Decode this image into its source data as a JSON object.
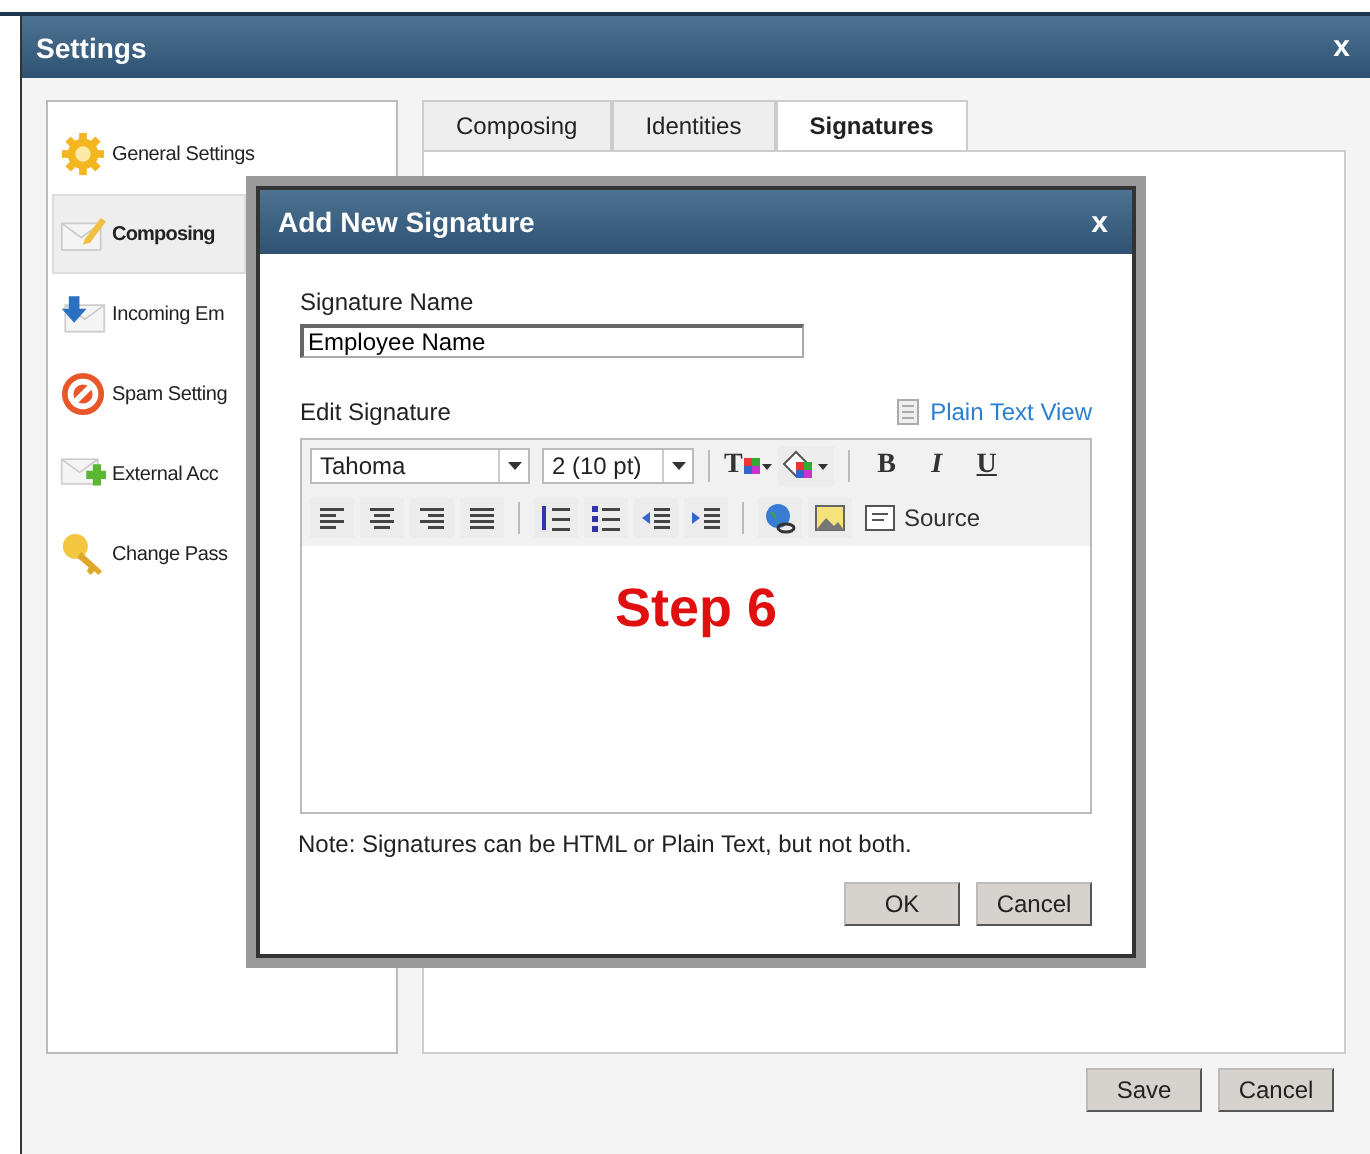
{
  "window": {
    "title": "Settings",
    "close": "x"
  },
  "sidebar": {
    "items": [
      {
        "label": "General Settings",
        "selected": false
      },
      {
        "label": "Composing",
        "selected": true
      },
      {
        "label": "Incoming Em",
        "selected": false
      },
      {
        "label": "Spam Setting",
        "selected": false
      },
      {
        "label": "External Acc",
        "selected": false
      },
      {
        "label": "Change Pass",
        "selected": false
      }
    ]
  },
  "tabs": [
    {
      "label": "Composing",
      "selected": false
    },
    {
      "label": "Identities",
      "selected": false
    },
    {
      "label": "Signatures",
      "selected": true
    }
  ],
  "dialog": {
    "title": "Add New Signature",
    "close": "x",
    "name_label": "Signature Name",
    "name_value": "Employee Name",
    "edit_label": "Edit Signature",
    "plain_text_link": "Plain Text View",
    "toolbar": {
      "font": "Tahoma",
      "size": "2 (10 pt)",
      "text_color_glyph": "T",
      "bold": "B",
      "italic": "I",
      "underline": "U",
      "source": "Source"
    },
    "content": "Step 6",
    "note": "Note: Signatures can be HTML or Plain Text, but not both.",
    "buttons": [
      "OK",
      "Cancel"
    ]
  },
  "buttons": [
    "Save",
    "Cancel"
  ]
}
